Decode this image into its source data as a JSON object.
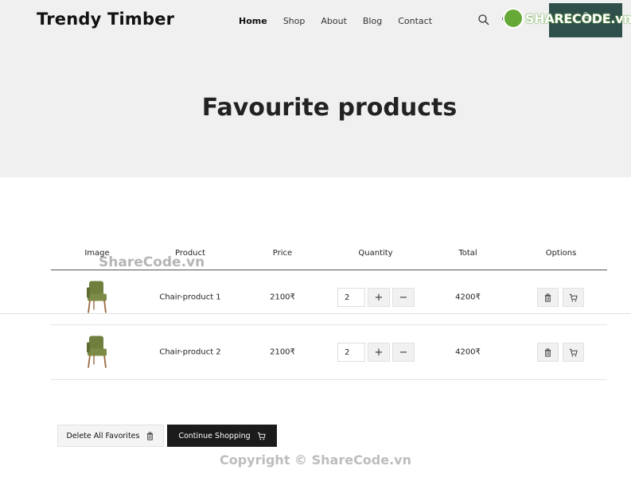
{
  "header": {
    "brand": "Trendy Timber",
    "nav": [
      "Home",
      "Shop",
      "About",
      "Blog",
      "Contact"
    ],
    "active_nav": "Home"
  },
  "watermark": {
    "logo_text": "SHARECODE.vn",
    "middle_text": "ShareCode.vn",
    "bottom_text": "Copyright © ShareCode.vn"
  },
  "hero": {
    "title": "Favourite products"
  },
  "table": {
    "headers": [
      "Image",
      "Product",
      "Price",
      "Quantity",
      "Total",
      "Options"
    ],
    "rows": [
      {
        "product": "Chair-product 1",
        "price": "2100₹",
        "quantity": "2",
        "total": "4200₹",
        "plus": "+",
        "minus": "−"
      },
      {
        "product": "Chair-product 2",
        "price": "2100₹",
        "quantity": "2",
        "total": "4200₹",
        "plus": "+",
        "minus": "−"
      }
    ]
  },
  "actions": {
    "delete_all": "Delete All Favorites",
    "continue": "Continue Shopping"
  },
  "colors": {
    "hero_bg": "#f0f0f0",
    "account_bg": "#2e4f4b",
    "dark_button": "#1b1b1b",
    "chair_green": "#6f7f3e"
  },
  "icons": {
    "search": "search-icon",
    "heart": "heart-icon",
    "trash": "trash-icon",
    "cart": "cart-icon",
    "user": "user-icon"
  }
}
